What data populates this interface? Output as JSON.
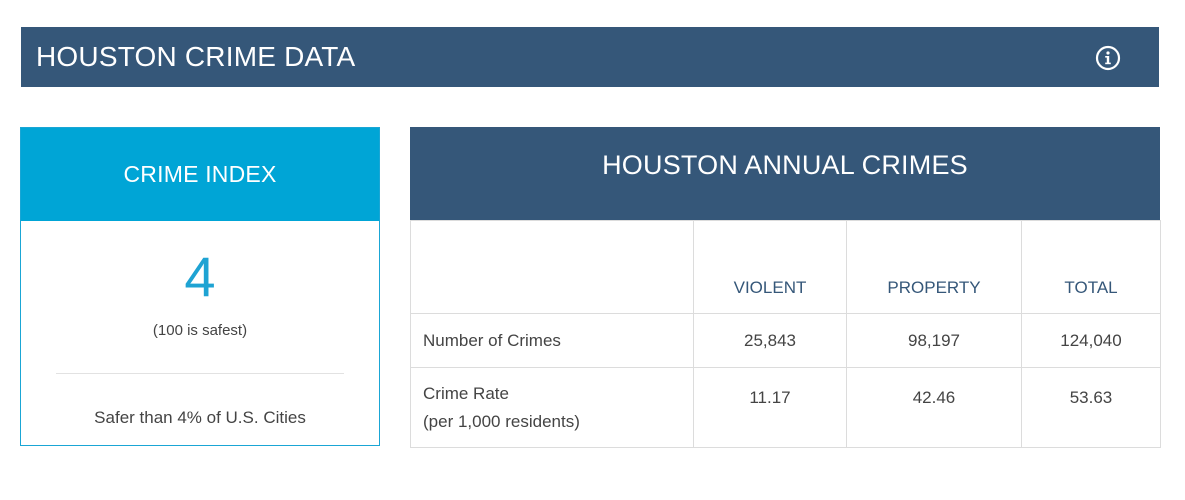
{
  "header": {
    "title": "HOUSTON CRIME DATA",
    "info_icon": "info-icon"
  },
  "index": {
    "heading": "CRIME INDEX",
    "value": "4",
    "note": "(100 is safest)",
    "safer": "Safer than 4% of U.S. Cities"
  },
  "annual": {
    "heading": "HOUSTON ANNUAL CRIMES",
    "columns": [
      "",
      "VIOLENT",
      "PROPERTY",
      "TOTAL"
    ],
    "rows": [
      {
        "label": "Number of Crimes",
        "sublabel": "",
        "values": [
          "25,843",
          "98,197",
          "124,040"
        ]
      },
      {
        "label": "Crime Rate",
        "sublabel": "(per 1,000 residents)",
        "values": [
          "11.17",
          "42.46",
          "53.63"
        ]
      }
    ]
  },
  "colors": {
    "header_bg": "#355779",
    "index_accent": "#00a5d6",
    "text": "#444444"
  }
}
